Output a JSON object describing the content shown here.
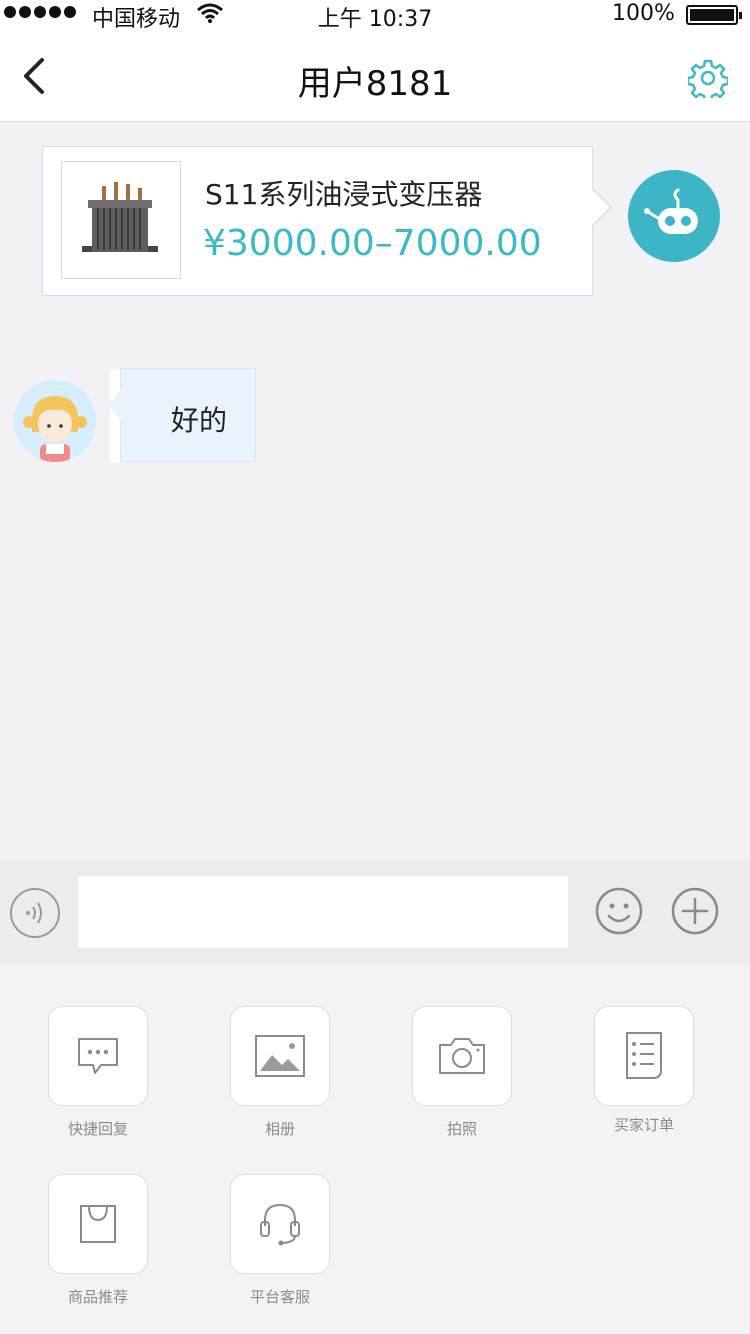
{
  "status_bar": {
    "carrier": "中国移动",
    "time": "上午 10:37",
    "battery": "100%",
    "battery_level": 1.0
  },
  "nav": {
    "title": "用户8181",
    "back_icon": "chevron-left-icon",
    "settings_icon": "gear-icon"
  },
  "messages": {
    "product_card": {
      "name": "S11系列油浸式变压器",
      "price": "¥3000.00–7000.00",
      "image_icon": "transformer-icon"
    },
    "user_message": {
      "text": "好的"
    }
  },
  "input_bar": {
    "placeholder": "",
    "value": "",
    "voice_icon": "voice-icon",
    "emoji_icon": "emoji-icon",
    "add_icon": "plus-icon"
  },
  "panel": {
    "items": [
      {
        "label": "快捷回复",
        "icon": "quick-reply-icon"
      },
      {
        "label": "相册",
        "icon": "album-icon"
      },
      {
        "label": "拍照",
        "icon": "camera-icon"
      },
      {
        "label": "买家订单",
        "icon": "order-list-icon"
      },
      {
        "label": "商品推荐",
        "icon": "shopping-bag-icon"
      },
      {
        "label": "平台客服",
        "icon": "headset-icon"
      }
    ]
  },
  "colors": {
    "accent": "#3cb8c9",
    "bubble": "#e8f3fd",
    "background": "#f2f2f6"
  }
}
